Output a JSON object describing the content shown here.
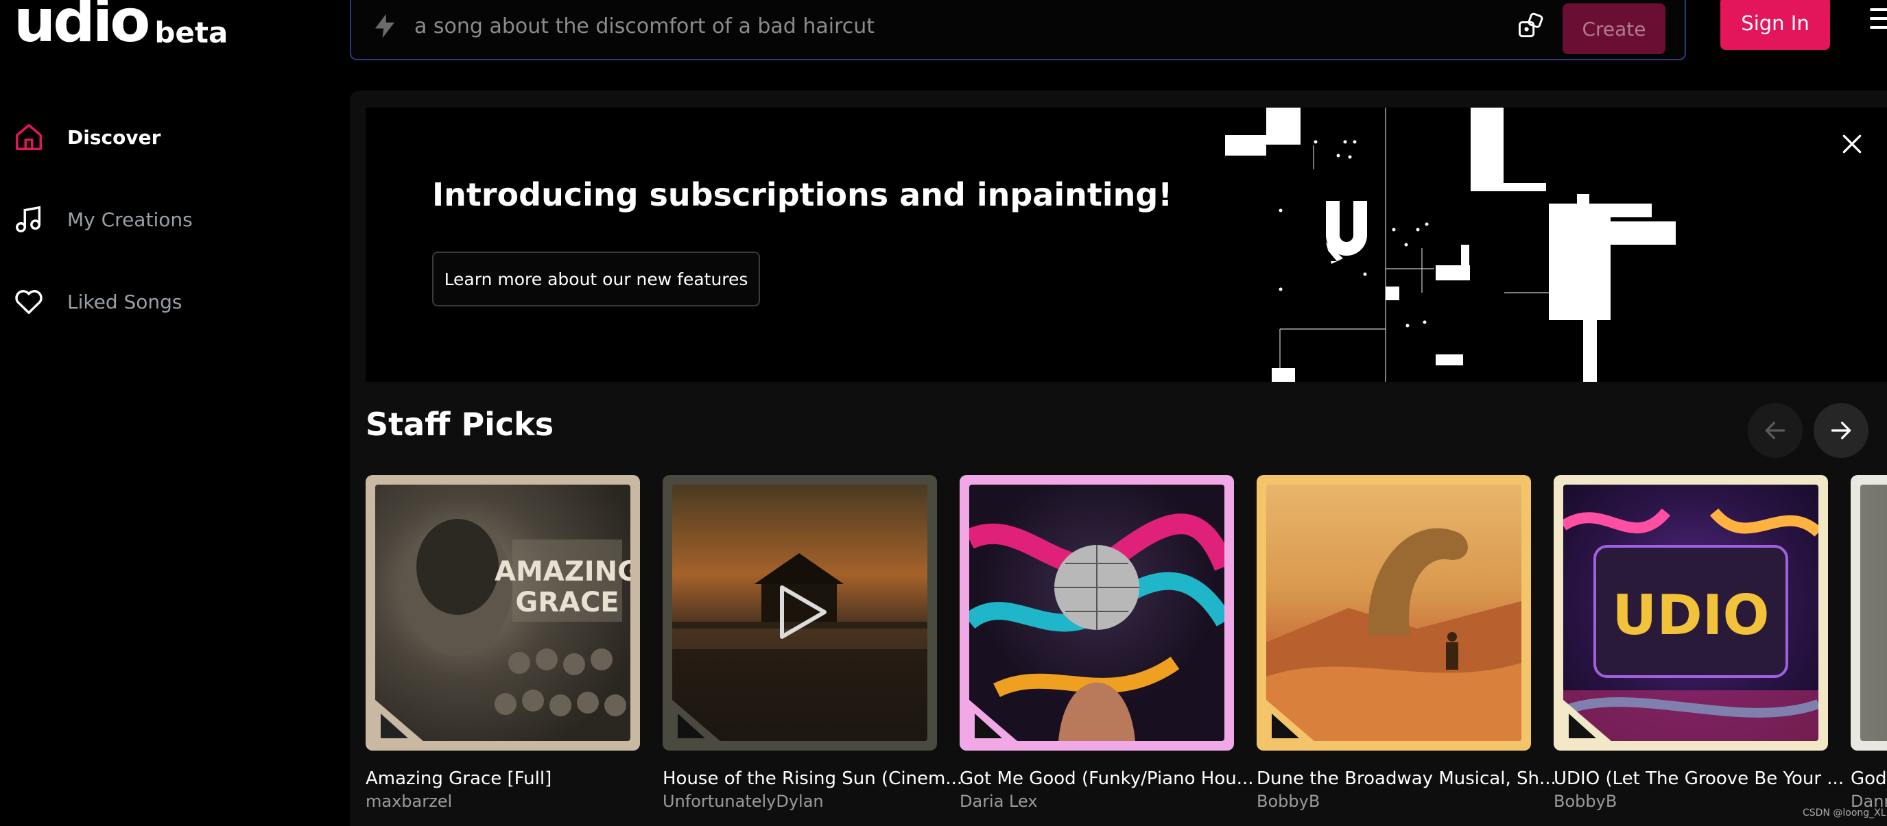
{
  "app": {
    "logo": "udio",
    "logo_badge": "beta"
  },
  "sidebar": {
    "items": [
      {
        "label": "Discover",
        "icon": "home-icon",
        "active": true
      },
      {
        "label": "My Creations",
        "icon": "music-note-icon",
        "active": false
      },
      {
        "label": "Liked Songs",
        "icon": "heart-icon",
        "active": false
      }
    ]
  },
  "topbar": {
    "prompt_placeholder": "a song about the discomfort of a bad haircut",
    "create_label": "Create",
    "signin_label": "Sign In"
  },
  "banner": {
    "title": "Introducing subscriptions and inpainting!",
    "button_label": "Learn more about our new features"
  },
  "staff_picks": {
    "title": "Staff Picks",
    "cards": [
      {
        "title": "Amazing Grace [Full]",
        "artist": "maxbarzel"
      },
      {
        "title": "House of the Rising Sun (Cinem...",
        "artist": "UnfortunatelyDylan"
      },
      {
        "title": "Got Me Good (Funky/Piano Hou...",
        "artist": "Daria Lex"
      },
      {
        "title": "Dune the Broadway Musical, Sh...",
        "artist": "BobbyB"
      },
      {
        "title": "UDIO (Let The Groove Be Your ...",
        "artist": "BobbyB"
      },
      {
        "title": "God,",
        "artist": "Dann"
      }
    ]
  },
  "watermark": "CSDN @loong_XL",
  "colors": {
    "accent": "#e3165b",
    "create_disabled": "#6a0f33",
    "prompt_border": "#2a3a7a"
  }
}
